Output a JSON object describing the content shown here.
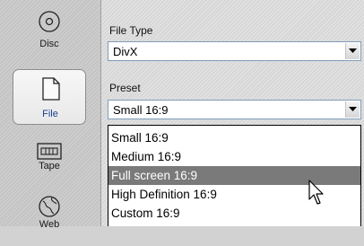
{
  "sidebar": {
    "tabs": [
      {
        "label": "Disc",
        "icon": "disc-icon",
        "active": false
      },
      {
        "label": "File",
        "icon": "file-icon",
        "active": true
      },
      {
        "label": "Tape",
        "icon": "tape-icon",
        "active": false
      },
      {
        "label": "Web",
        "icon": "web-icon",
        "active": false
      }
    ]
  },
  "main": {
    "file_type": {
      "label": "File Type",
      "value": "DivX"
    },
    "preset": {
      "label": "Preset",
      "value": "Small 16:9",
      "options": [
        "Small 16:9",
        "Medium 16:9",
        "Full screen 16:9",
        "High Definition 16:9",
        "Custom 16:9"
      ],
      "highlighted": "Full screen 16:9"
    }
  },
  "colors": {
    "accent_label": "#1c3f95",
    "highlight": "#7a7a7a",
    "field_border": "#7f9db9"
  }
}
